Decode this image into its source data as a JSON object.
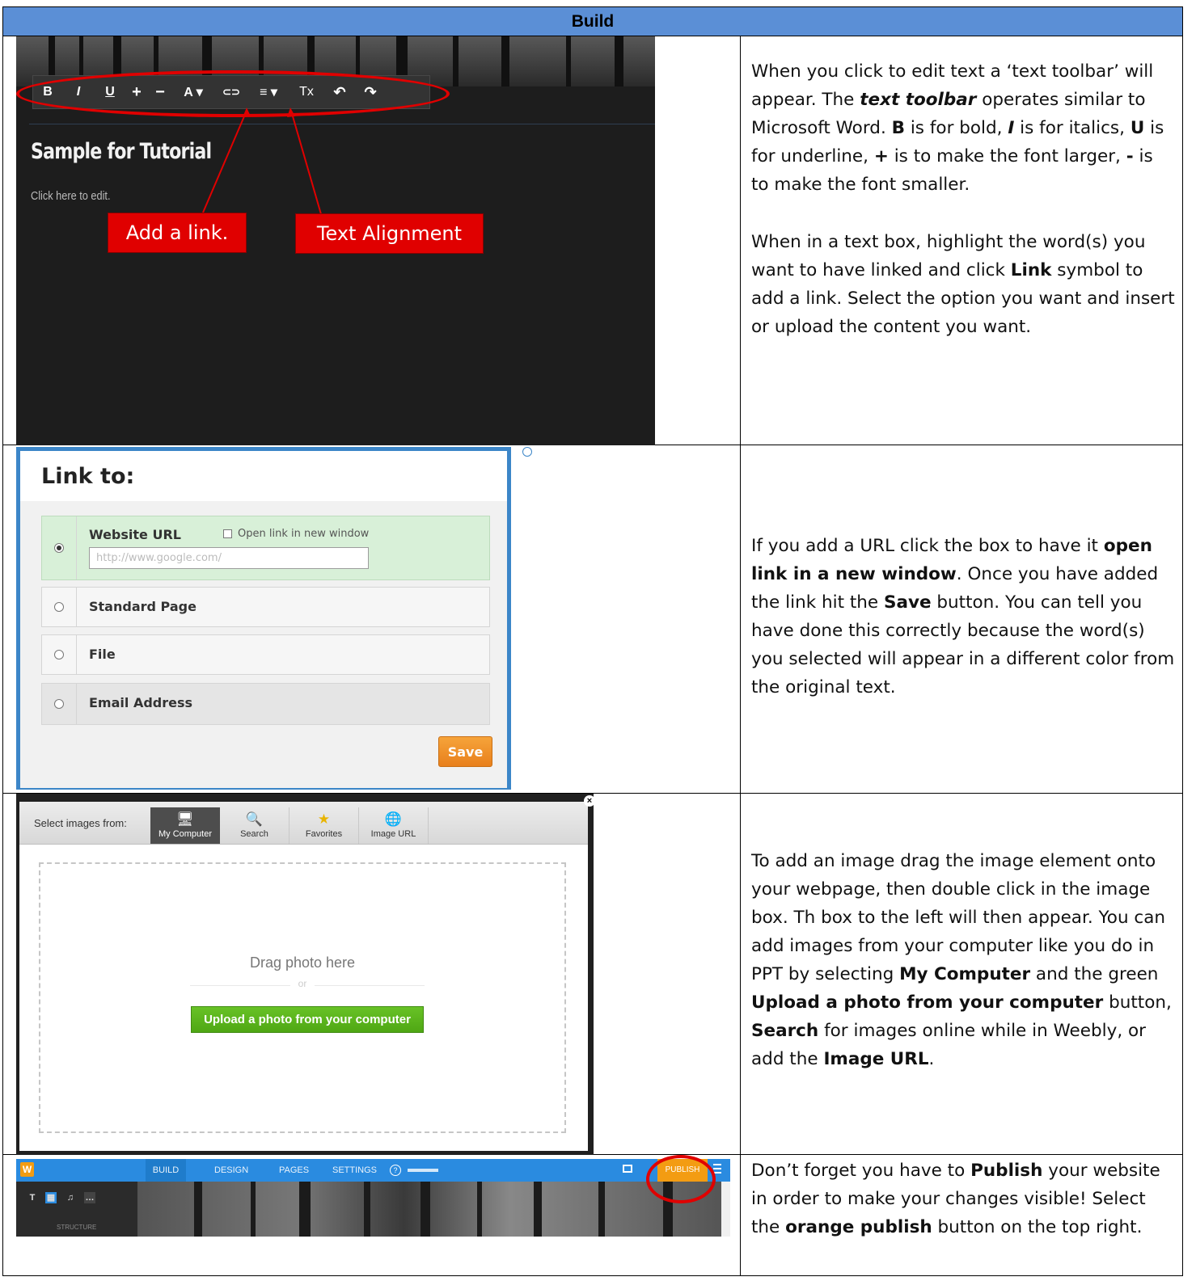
{
  "header": {
    "title": "Build"
  },
  "row1": {
    "toolbar": [
      "B",
      "I",
      "U",
      "+",
      "−",
      "A ▾",
      "⊂⊃",
      "≡ ▾",
      "Tx",
      "↶",
      "↷"
    ],
    "sample_title": "Sample for Tutorial",
    "click_edit": "Click here to edit.",
    "callout_link": "Add a link.",
    "callout_align": "Text Alignment",
    "desc": {
      "p1_a": "When you click to edit text a ‘text toolbar’ will appear. The ",
      "p1_b": "text toolbar",
      "p1_c": " operates similar to Microsoft Word. ",
      "p1_d": "B",
      "p1_e": " is for bold, ",
      "p1_f": "I",
      "p1_g": " is for italics, ",
      "p1_h": "U",
      "p1_i": " is for underline, ",
      "p1_j": "+",
      "p1_k": " is to make the font larger, ",
      "p1_l": "-",
      "p1_m": " is to make the font smaller.",
      "p2_a": "When in a text box, highlight the word(s) you want to have linked and click ",
      "p2_b": "Link",
      "p2_c": " symbol to add a link. Select the option you want and insert or upload the content you want."
    }
  },
  "row2": {
    "dialog_title": "Link to:",
    "options": [
      "Website URL",
      "Standard Page",
      "File",
      "Email Address"
    ],
    "new_window": "Open link in new window",
    "url_placeholder": "http://www.google.com/",
    "save": "Save",
    "desc": {
      "a": "If you add a URL click the box to have it ",
      "b": "open link in a new window",
      "c": ". Once you have added the link hit the ",
      "d": "Save",
      "e": " button. You can tell you have done this correctly because the word(s) you selected will appear in a different color from the original text."
    }
  },
  "row3": {
    "select_from": "Select images from:",
    "tabs": [
      {
        "icon": "🖥",
        "label": "My Computer"
      },
      {
        "icon": "🔍",
        "label": "Search"
      },
      {
        "icon": "★",
        "label": "Favorites"
      },
      {
        "icon": "🌐",
        "label": "Image URL"
      }
    ],
    "drag_text": "Drag photo here",
    "or": "or",
    "upload": "Upload a photo from your computer",
    "close": "×",
    "desc": {
      "a": "To add an image drag the image element onto your webpage, then double click in the image box. Th box to the left will then appear. You can add images from your computer like you do in PPT by selecting ",
      "b": "My Computer",
      "c": " and the green ",
      "d": "Upload a photo from your computer",
      "e": " button, ",
      "f": "Search",
      "g": " for images online while in Weebly, or add the ",
      "h": "Image URL",
      "i": "."
    }
  },
  "row4": {
    "logo": "W",
    "nav": [
      "BUILD",
      "DESIGN",
      "PAGES",
      "SETTINGS"
    ],
    "help": "?",
    "publish": "PUBLISH",
    "sidebar_icons": [
      "T",
      "▦",
      "♫",
      "…"
    ],
    "structure": "STRUCTURE",
    "desc": {
      "a": "Don’t forget you have to ",
      "b": "Publish",
      "c": " your website in order to make your changes visible! Select the ",
      "d": "orange publish",
      "e": " button on the top right."
    }
  }
}
